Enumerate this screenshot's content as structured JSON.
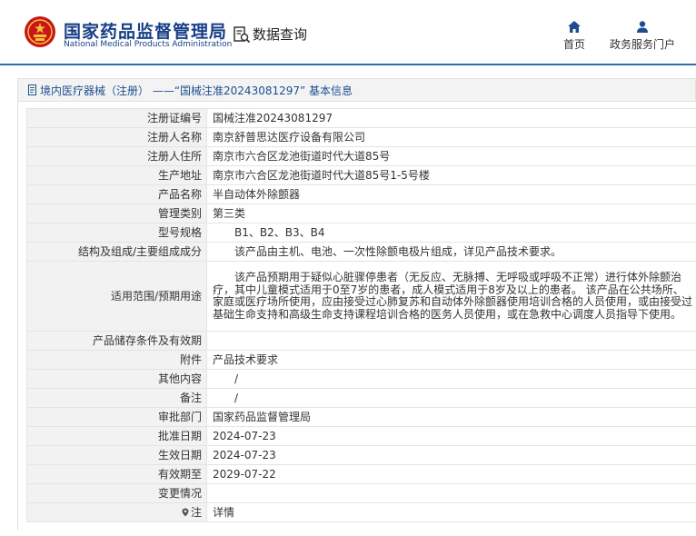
{
  "header": {
    "org_name": "国家药品监督管理局",
    "org_name_en": "National Medical Products Administration",
    "query_label": "数据查询",
    "nav": [
      {
        "label": "首页",
        "icon": "home-icon"
      },
      {
        "label": "政务服务门户",
        "icon": "user-icon"
      }
    ]
  },
  "breadcrumb": {
    "text": "境内医疗器械（注册） ——“国械注准20243081297” 基本信息"
  },
  "record": {
    "rows": [
      {
        "label": "注册证编号",
        "value": "国械注准20243081297"
      },
      {
        "label": "注册人名称",
        "value": "南京舒普思达医疗设备有限公司"
      },
      {
        "label": "注册人住所",
        "value": "南京市六合区龙池街道时代大道85号"
      },
      {
        "label": "生产地址",
        "value": "南京市六合区龙池街道时代大道85号1-5号楼"
      },
      {
        "label": "产品名称",
        "value": "半自动体外除颤器"
      },
      {
        "label": "管理类别",
        "value": "第三类"
      },
      {
        "label": "型号规格",
        "value": "B1、B2、B3、B4"
      },
      {
        "label": "结构及组成/主要组成成分",
        "value": "该产品由主机、电池、一次性除颤电极片组成，详见产品技术要求。"
      },
      {
        "label": "适用范围/预期用途",
        "value": "该产品预期用于疑似心脏骤停患者（无反应、无脉搏、无呼吸或呼吸不正常）进行体外除颤治疗，其中儿童模式适用于0至7岁的患者，成人模式适用于8岁及以上的患者。        该产品在公共场所、家庭或医疗场所使用，应由接受过心肺复苏和自动体外除颤器使用培训合格的人员使用，或由接受过基础生命支持和高级生命支持课程培训合格的医务人员使用，或在急救中心调度人员指导下使用。"
      },
      {
        "label": "产品储存条件及有效期",
        "value": ""
      },
      {
        "label": "附件",
        "value": "产品技术要求"
      },
      {
        "label": "其他内容",
        "value": "/"
      },
      {
        "label": "备注",
        "value": "/"
      },
      {
        "label": "审批部门",
        "value": "国家药品监督管理局"
      },
      {
        "label": "批准日期",
        "value": "2024-07-23"
      },
      {
        "label": "生效日期",
        "value": "2024-07-23"
      },
      {
        "label": "有效期至",
        "value": "2029-07-22"
      },
      {
        "label": "变更情况",
        "value": ""
      },
      {
        "label": "注",
        "value": "详情"
      }
    ]
  },
  "colors": {
    "brand": "#173f86",
    "accent_line": "#2c6fb1",
    "link": "#2a6db3",
    "label_bg": "#f2f2f2"
  }
}
